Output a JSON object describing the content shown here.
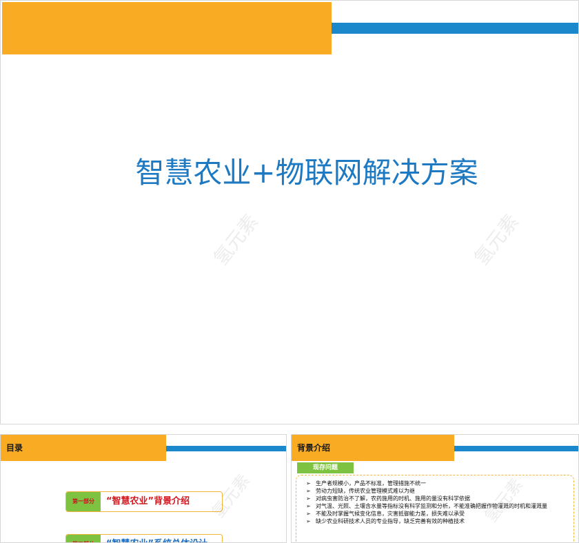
{
  "main_slide": {
    "title": "智慧农业+物联网解决方案",
    "watermark": "氢元素"
  },
  "agenda_slide": {
    "heading": "目录",
    "items": [
      {
        "tag": "第一部分",
        "text": "“智慧农业”背景介绍"
      },
      {
        "tag": "第二部分",
        "text": "“智慧农业”系统总体设计"
      }
    ]
  },
  "background_slide": {
    "heading": "背景介绍",
    "sub_label": "现存问题",
    "issues": [
      "生产者规模小，产品不标准，管理措施不统一",
      "劳动力短缺，传统农业管理模式难以为继",
      "对病虫害防治不了解，农药施用的时机、施用的量没有科学依据",
      "对气温、光照、土壤含水量等指标没有科学监测和分析，不能准确把握作物灌溉的时机和灌溉量",
      "不能及时掌握气候变化信息，灾害抵御能力差，损失难以承受",
      "缺少农业科研技术人员的专业指导，缺乏完善有效的种植技术"
    ]
  },
  "colors": {
    "orange": "#f9ab24",
    "blue": "#1b88cc",
    "title_blue": "#1d79c2",
    "green": "#7ec242",
    "red": "#d2171e"
  }
}
